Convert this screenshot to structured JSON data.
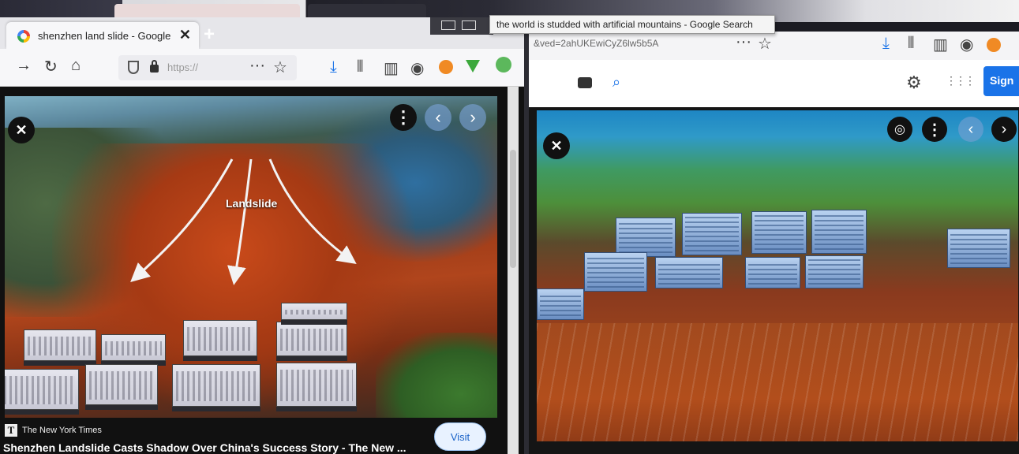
{
  "tooltip": "the world is studded with artificial mountains - Google Search",
  "left_window": {
    "tab_title": "shenzhen land slide - Google S",
    "url": "https://",
    "image_overlay_label": "Landslide",
    "source": "The New York Times",
    "headline": "Shenzhen Landslide Casts Shadow Over China's Success Story - The New ...",
    "visit_label": "Visit"
  },
  "right_window": {
    "url_fragment": "&ved=2ahUKEwiCyZ6lw5b5A",
    "sign_in_label": "Sign"
  },
  "icons": {
    "close": "✕",
    "more": "⋮",
    "prev": "‹",
    "next": "›",
    "tab_close": "✕",
    "new_tab": "+",
    "back": "→",
    "reload": "↻",
    "home": "⌂",
    "overflow": "···",
    "star": "☆",
    "download": "⤓",
    "library": "⫴",
    "sidebar": "▥",
    "account": "◉",
    "apps": "⋮⋮⋮"
  },
  "colors": {
    "accent_blue": "#1a73e8",
    "mud_red": "#b0451c"
  }
}
